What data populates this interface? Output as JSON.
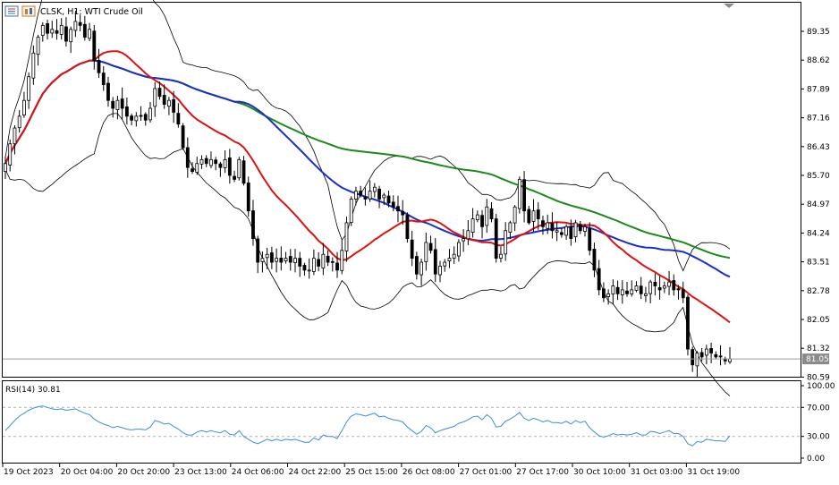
{
  "chart_data": [
    {
      "type": "candlestick",
      "symbol": "CLSK",
      "timeframe": "H1",
      "title": "CLSK, H1: WTI Crude Oil",
      "y_ticks": [
        "89.35",
        "88.62",
        "87.89",
        "87.16",
        "86.43",
        "85.70",
        "84.97",
        "84.24",
        "83.51",
        "82.78",
        "82.05",
        "81.32",
        "80.59"
      ],
      "y_range": [
        80.35,
        90.0
      ],
      "current_price": "81.05",
      "x_tick_labels": [
        "19 Oct 2023",
        "20 Oct 04:00",
        "20 Oct 20:00",
        "23 Oct 13:00",
        "24 Oct 06:00",
        "24 Oct 22:00",
        "25 Oct 15:00",
        "26 Oct 08:00",
        "27 Oct 01:00",
        "27 Oct 17:00",
        "30 Oct 10:00",
        "31 Oct 03:00",
        "31 Oct 19:00"
      ],
      "indicators": [
        "Bollinger Bands",
        "Moving Average (red)",
        "Moving Average (blue)",
        "Moving Average (green)"
      ],
      "colors": {
        "ma_fast": "#e01010",
        "ma_mid": "#1a2ecc",
        "ma_slow": "#1a8a1a",
        "bands": "#000000",
        "candles": "#000000"
      },
      "close_series": [
        86.0,
        86.5,
        86.9,
        87.2,
        87.6,
        88.2,
        88.8,
        89.2,
        89.5,
        89.3,
        89.4,
        89.3,
        89.5,
        89.1,
        89.4,
        89.6,
        89.5,
        89.2,
        89.4,
        88.6,
        88.3,
        88.0,
        87.6,
        87.4,
        87.6,
        87.4,
        87.2,
        87.1,
        87.2,
        87.2,
        87.1,
        87.4,
        87.9,
        87.7,
        87.5,
        87.6,
        87.3,
        87.0,
        86.4,
        85.9,
        85.8,
        86.0,
        86.1,
        86.0,
        86.1,
        86.0,
        85.9,
        86.1,
        85.7,
        85.6,
        86.1,
        85.5,
        84.8,
        84.1,
        83.5,
        83.6,
        83.7,
        83.5,
        83.6,
        83.5,
        83.6,
        83.5,
        83.6,
        83.4,
        83.3,
        83.3,
        83.6,
        83.4,
        83.7,
        83.5,
        83.5,
        83.3,
        83.8,
        84.5,
        85.1,
        85.3,
        85.2,
        85.1,
        85.3,
        85.4,
        85.1,
        85.2,
        85.0,
        84.9,
        84.8,
        84.7,
        84.1,
        83.6,
        83.2,
        83.5,
        84.0,
        83.8,
        83.2,
        83.4,
        83.5,
        83.6,
        83.7,
        84.0,
        84.1,
        84.3,
        84.6,
        84.7,
        84.4,
        84.9,
        84.6,
        83.6,
        83.7,
        84.3,
        84.5,
        84.9,
        85.6,
        84.8,
        84.5,
        84.8,
        84.6,
        84.4,
        84.5,
        84.3,
        84.3,
        84.2,
        84.4,
        84.1,
        84.5,
        84.3,
        84.4,
        83.8,
        83.3,
        82.8,
        82.6,
        82.7,
        82.9,
        82.7,
        82.8,
        82.7,
        82.8,
        82.9,
        82.7,
        82.7,
        83.0,
        82.9,
        82.8,
        82.9,
        83.0,
        82.8,
        82.8,
        82.6,
        81.3,
        80.9,
        81.2,
        81.1,
        81.3,
        81.2,
        81.1,
        81.1,
        81.0,
        81.05
      ]
    },
    {
      "type": "line",
      "title": "RSI(14) 30.81",
      "name": "RSI(14)",
      "current_value": "30.81",
      "y_ticks": [
        "100.00",
        "70.00",
        "30.00",
        "0.00"
      ],
      "levels": [
        70,
        30
      ],
      "y_range": [
        0,
        100
      ],
      "color": "#3a8fd8",
      "values": [
        38,
        45,
        52,
        58,
        62,
        66,
        69,
        71,
        72,
        70,
        68,
        67,
        68,
        66,
        67,
        68,
        65,
        62,
        60,
        54,
        50,
        47,
        45,
        42,
        44,
        42,
        40,
        39,
        40,
        40,
        39,
        43,
        52,
        50,
        47,
        48,
        44,
        40,
        35,
        32,
        32,
        36,
        38,
        36,
        38,
        36,
        35,
        38,
        33,
        32,
        38,
        30,
        26,
        22,
        20,
        23,
        26,
        24,
        26,
        24,
        26,
        25,
        26,
        24,
        22,
        22,
        28,
        25,
        32,
        30,
        30,
        27,
        38,
        50,
        58,
        61,
        60,
        58,
        60,
        62,
        57,
        58,
        55,
        53,
        52,
        50,
        43,
        38,
        33,
        37,
        45,
        42,
        35,
        38,
        40,
        42,
        44,
        48,
        50,
        53,
        57,
        58,
        53,
        60,
        55,
        43,
        44,
        51,
        54,
        58,
        63,
        55,
        52,
        55,
        53,
        50,
        52,
        49,
        49,
        48,
        51,
        47,
        52,
        49,
        51,
        42,
        36,
        31,
        29,
        31,
        34,
        32,
        33,
        32,
        33,
        35,
        32,
        32,
        37,
        36,
        34,
        36,
        38,
        34,
        34,
        30,
        20,
        17,
        23,
        22,
        26,
        25,
        24,
        24,
        23,
        30.81
      ]
    }
  ]
}
